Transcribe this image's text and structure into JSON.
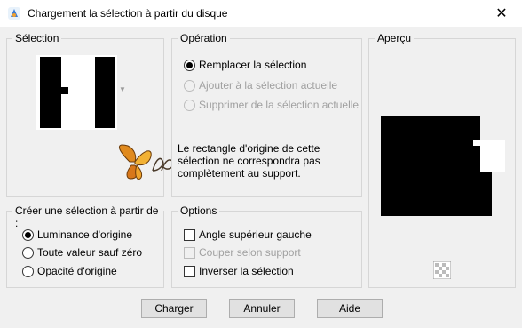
{
  "window": {
    "title": "Chargement la sélection à partir du disque",
    "close_glyph": "✕",
    "app_icon": "app-logo-icon"
  },
  "selection_group": {
    "label": "Sélection",
    "dropdown_icon": "chevron-down-icon"
  },
  "operation_group": {
    "label": "Opération",
    "options": [
      {
        "label": "Remplacer la sélection",
        "checked": true,
        "enabled": true
      },
      {
        "label": "Ajouter à la sélection actuelle",
        "checked": false,
        "enabled": false
      },
      {
        "label": "Supprimer de la sélection actuelle",
        "checked": false,
        "enabled": false
      }
    ],
    "message": "Le rectangle d'origine de cette sélection ne correspondra pas complètement au support."
  },
  "preview_group": {
    "label": "Aperçu",
    "transparency_icon": "checkerboard-icon"
  },
  "create_group": {
    "label": "Créer une sélection à partir de :",
    "options": [
      {
        "label": "Luminance d'origine",
        "checked": true
      },
      {
        "label": "Toute valeur sauf zéro",
        "checked": false
      },
      {
        "label": "Opacité d'origine",
        "checked": false
      }
    ]
  },
  "options_group": {
    "label": "Options",
    "items": [
      {
        "label": "Angle supérieur gauche",
        "checked": false,
        "enabled": true
      },
      {
        "label": "Couper selon support",
        "checked": false,
        "enabled": false
      },
      {
        "label": "Inverser la sélection",
        "checked": false,
        "enabled": true
      }
    ]
  },
  "buttons": {
    "load": "Charger",
    "cancel": "Annuler",
    "help": "Aide"
  },
  "colors": {
    "background": "#f0f0f0",
    "border": "#d6d6d6",
    "button_bg": "#e1e1e1"
  }
}
